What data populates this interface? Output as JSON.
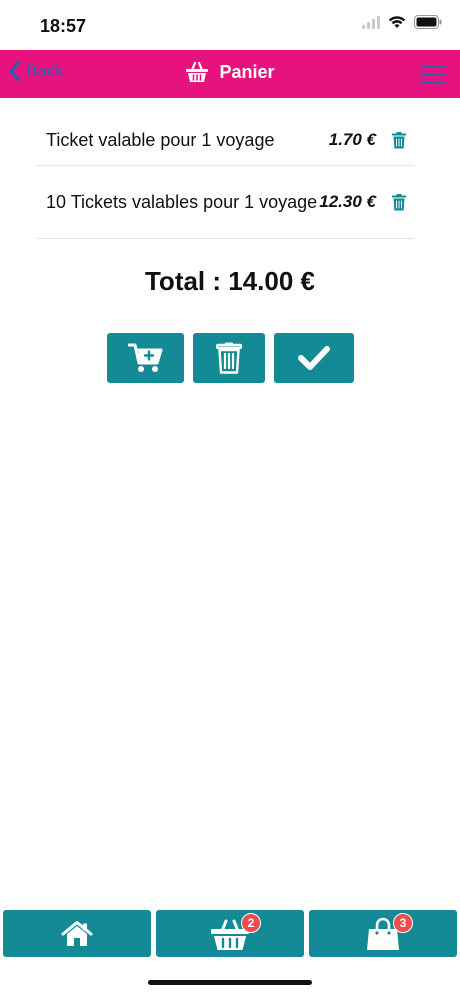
{
  "status_bar": {
    "time": "18:57"
  },
  "navbar": {
    "back_label": "Back",
    "title": "Panier",
    "title_icon": "basket-icon",
    "menu_icon": "hamburger-icon",
    "background": "#e6137f"
  },
  "cart": {
    "items": [
      {
        "name": "Ticket valable pour 1 voyage",
        "price": "1.70 €"
      },
      {
        "name": "10 Tickets valables pour 1 voyage",
        "price": "12.30 €"
      }
    ],
    "total": "Total : 14.00 €"
  },
  "actions": [
    {
      "name": "add-to-cart-button",
      "icon": "cart-plus-icon"
    },
    {
      "name": "clear-cart-button",
      "icon": "trash-icon"
    },
    {
      "name": "validate-button",
      "icon": "check-icon"
    }
  ],
  "tabbar": {
    "tabs": [
      {
        "name": "home",
        "icon": "home-icon"
      },
      {
        "name": "basket",
        "icon": "basket-icon",
        "badge": "2"
      },
      {
        "name": "orders",
        "icon": "shopping-bag-icon",
        "badge": "3"
      }
    ]
  },
  "colors": {
    "accent": "#138a95",
    "brand": "#e6137f",
    "badge": "#ec4d4d",
    "link": "#2e5fa9"
  }
}
